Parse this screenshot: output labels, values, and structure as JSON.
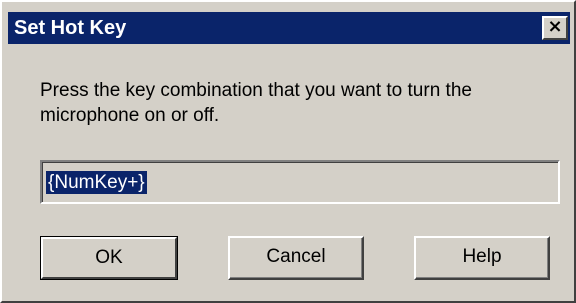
{
  "dialog": {
    "title": "Set Hot Key",
    "close_label": "×",
    "message": "Press the key combination that you want to turn the microphone on or off.",
    "hotkey_value": "{NumKey+}"
  },
  "buttons": {
    "ok": "OK",
    "cancel": "Cancel",
    "help": "Help"
  },
  "colors": {
    "titlebar": "#0a246a",
    "face": "#d4d0c8",
    "selection": "#0a246a"
  }
}
